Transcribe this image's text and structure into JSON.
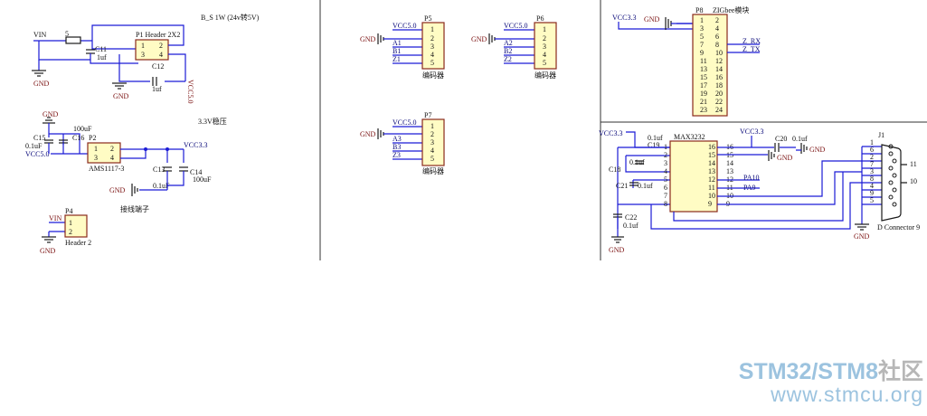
{
  "regulator24": {
    "title": "B_S 1W (24v转5V)",
    "vin_label": "VIN",
    "vcc5_label": "VCC5.0",
    "gnd_label": "GND",
    "header_label": "P1 Header 2X2",
    "pins": [
      "1",
      "2",
      "3",
      "4"
    ],
    "r_label": "5",
    "c11": "C11",
    "c11_val": "1uf",
    "c12": "C12",
    "c12_val": "1uf"
  },
  "regulator33": {
    "title": "3.3V稳压",
    "gnd_label": "GND",
    "c15": "C15",
    "c15_val": "0.1uF",
    "c16": "C16",
    "c16_val": "100uF",
    "vcc5_label": "VCC5.0",
    "p2_label": "P2",
    "ams_label": "AMS1117-3",
    "pins": [
      "1",
      "2",
      "3",
      "4"
    ],
    "vcc33_label": "VCC3.3",
    "c13": "C13",
    "c13_val": "0.1uF",
    "c14": "C14",
    "c14_val": "100uF"
  },
  "terminal": {
    "title": "接线端子",
    "p4_label": "P4",
    "vin_label": "VIN",
    "gnd_label": "GND",
    "pins": [
      "1",
      "2"
    ],
    "header_label": "Header 2"
  },
  "encoders": [
    {
      "ref": "P5",
      "vcc": "VCC5.0",
      "gnd": "GND",
      "nets": [
        "A1",
        "B1",
        "Z1"
      ],
      "name": "编码器",
      "pins": [
        "1",
        "2",
        "3",
        "4",
        "5"
      ]
    },
    {
      "ref": "P6",
      "vcc": "VCC5.0",
      "gnd": "GND",
      "nets": [
        "A2",
        "B2",
        "Z2"
      ],
      "name": "编码器",
      "pins": [
        "1",
        "2",
        "3",
        "4",
        "5"
      ]
    },
    {
      "ref": "P7",
      "vcc": "VCC5.0",
      "gnd": "GND",
      "nets": [
        "A3",
        "B3",
        "Z3"
      ],
      "name": "编码器",
      "pins": [
        "1",
        "2",
        "3",
        "4",
        "5"
      ]
    }
  ],
  "zigbee": {
    "vcc_label": "VCC3.3",
    "gnd_label": "GND",
    "ref": "P8",
    "title": "ZIGbee模块",
    "pins_left": [
      "1",
      "3",
      "5",
      "7",
      "9",
      "11",
      "13",
      "15",
      "17",
      "19",
      "21",
      "23"
    ],
    "pins_right": [
      "2",
      "4",
      "6",
      "8",
      "10",
      "12",
      "14",
      "16",
      "18",
      "20",
      "22",
      "24"
    ],
    "z_rx": "Z_RX",
    "z_tx": "Z_TX"
  },
  "max3232": {
    "vcc_label": "VCC3.3",
    "vcc_label2": "VCC3.3",
    "chip_label": "MAX3232",
    "pins_left": [
      "1",
      "2",
      "3",
      "4",
      "5",
      "6",
      "7",
      "8"
    ],
    "pins_right": [
      "16",
      "15",
      "14",
      "13",
      "12",
      "11",
      "10",
      "9"
    ],
    "c19": "C19",
    "c19_val": "0.1uf",
    "c18": "C18",
    "c18_val": "0.1uf",
    "c21": "C21",
    "c21_val": "0.1uf",
    "c22": "C22",
    "c22_val": "0.1uf",
    "c20": "C20",
    "c20_val": "0.1uf",
    "gnd_label": "GND",
    "pa10": "PA10",
    "pa9": "PA9"
  },
  "dconn": {
    "ref": "J1",
    "pins": [
      "1",
      "6",
      "2",
      "7",
      "3",
      "8",
      "4",
      "9",
      "5"
    ],
    "out11": "11",
    "out10": "10",
    "name": "D Connector 9",
    "gnd_label": "GND"
  },
  "watermark": {
    "line1a": "STM32/STM8",
    "line1b": "社区",
    "line2": "www.stmcu.org"
  }
}
